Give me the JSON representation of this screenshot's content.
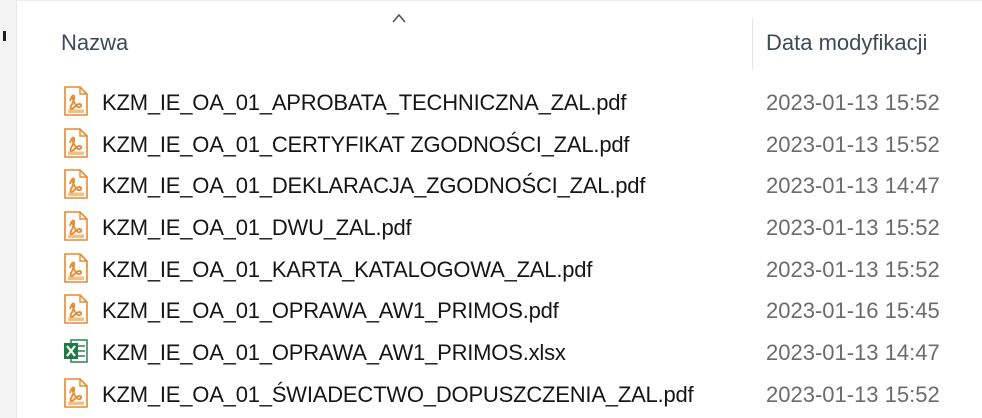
{
  "header": {
    "name_label": "Nazwa",
    "date_label": "Data modyfikacji",
    "sort_icon": "chevron-up-icon"
  },
  "files": [
    {
      "name": "KZM_IE_OA_01_APROBATA_TECHNICZNA_ZAL.pdf",
      "date": "2023-01-13 15:52",
      "icon": "pdf-file-icon"
    },
    {
      "name": "KZM_IE_OA_01_CERTYFIKAT ZGODNOŚCI_ZAL.pdf",
      "date": "2023-01-13 15:52",
      "icon": "pdf-file-icon"
    },
    {
      "name": "KZM_IE_OA_01_DEKLARACJA_ZGODNOŚCI_ZAL.pdf",
      "date": "2023-01-13 14:47",
      "icon": "pdf-file-icon"
    },
    {
      "name": "KZM_IE_OA_01_DWU_ZAL.pdf",
      "date": "2023-01-13 15:52",
      "icon": "pdf-file-icon"
    },
    {
      "name": "KZM_IE_OA_01_KARTA_KATALOGOWA_ZAL.pdf",
      "date": "2023-01-13 15:52",
      "icon": "pdf-file-icon"
    },
    {
      "name": "KZM_IE_OA_01_OPRAWA_AW1_PRIMOS.pdf",
      "date": "2023-01-16 15:45",
      "icon": "pdf-file-icon"
    },
    {
      "name": "KZM_IE_OA_01_OPRAWA_AW1_PRIMOS.xlsx",
      "date": "2023-01-13 14:47",
      "icon": "excel-file-icon"
    },
    {
      "name": "KZM_IE_OA_01_ŚWIADECTWO_DOPUSZCZENIA_ZAL.pdf",
      "date": "2023-01-13 15:52",
      "icon": "pdf-file-icon"
    }
  ],
  "colors": {
    "pdf_icon": "#e8892c",
    "excel_icon": "#1d7a45",
    "header_text": "#3c4a5a",
    "date_text": "#6b6b6b"
  }
}
